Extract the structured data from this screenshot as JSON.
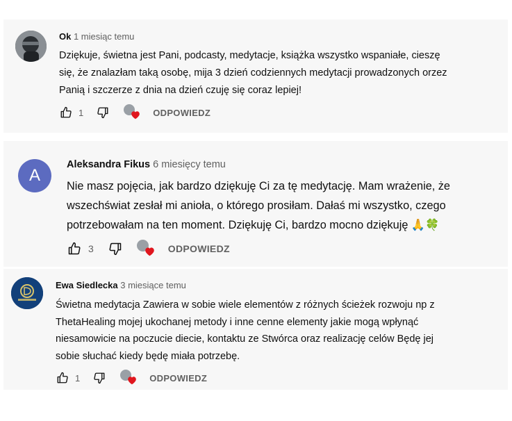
{
  "comments": [
    {
      "author": "Ok",
      "time": "1 miesiąc temu",
      "text": "Dziękuje, świetna jest Pani, podcasty, medytacje, książka wszystko wspaniałe, cieszę\nsię, że znalazłam taką osobę, mija 3 dzień codziennych medytacji prowadzonych orzez\nPanią i szczerze z dnia na dzień czuję się coraz lepiej!",
      "likes": "1",
      "reply_label": "ODPOWIEDZ",
      "avatar_icon": "ninja-photo-avatar"
    },
    {
      "author": "Aleksandra Fikus",
      "time": "6 miesięcy temu",
      "text": "Nie masz pojęcia, jak bardzo dziękuję Ci za tę medytację. Mam wrażenie, że\nwszechświat zesłał mi anioła, o którego prosiłam. Dałaś mi wszystko, czego\npotrzebowałam na ten moment. Dziękuję Ci, bardzo mocno dziękuję 🙏🍀",
      "likes": "3",
      "reply_label": "ODPOWIEDZ",
      "avatar_letter": "A",
      "avatar_color": "#5c6bc0"
    },
    {
      "author": "Ewa Siedlecka",
      "time": "3 miesiące temu",
      "text": "Świetna medytacja Zawiera w sobie wiele elementów z różnych ścieżek rozwoju np z\nThetaHealing mojej ukochanej metody i inne cenne elementy jakie mogą wpłynąć\nniesamowicie na poczucie diecie, kontaktu ze Stwórca oraz realizację celów Będę jej\nsobie słuchać kiedy będę miała potrzebę.",
      "likes": "1",
      "reply_label": "ODPOWIEDZ",
      "avatar_icon": "logo-avatar"
    }
  ],
  "colors": {
    "card_bg": "#f7f7f7",
    "heart": "#e0161e",
    "secondary_text": "#606060"
  }
}
